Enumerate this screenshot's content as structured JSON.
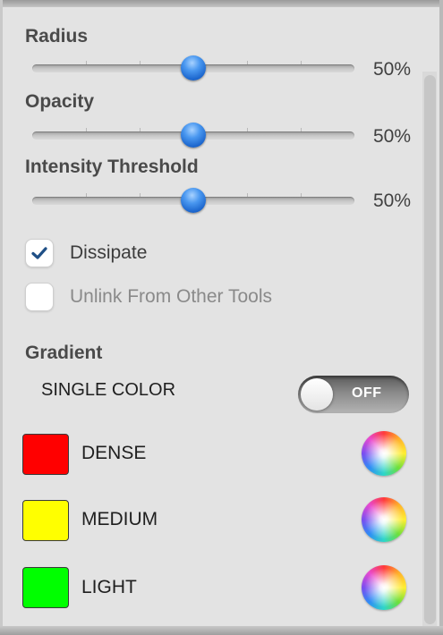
{
  "sliders": [
    {
      "label": "Radius",
      "value": 50,
      "value_text": "50%"
    },
    {
      "label": "Opacity",
      "value": 50,
      "value_text": "50%"
    },
    {
      "label": "Intensity Threshold",
      "value": 50,
      "value_text": "50%"
    }
  ],
  "checkboxes": [
    {
      "label": "Dissipate",
      "checked": true
    },
    {
      "label": "Unlink From Other Tools",
      "checked": false
    }
  ],
  "gradient": {
    "title": "Gradient",
    "single_color_label": "SINGLE COLOR",
    "toggle_text": "OFF",
    "toggle_on": false,
    "swatches": [
      {
        "label": "DENSE",
        "color": "#ff0000"
      },
      {
        "label": "MEDIUM",
        "color": "#ffff00"
      },
      {
        "label": "LIGHT",
        "color": "#00ff00"
      }
    ]
  },
  "colors": {
    "slider_knob": "#2a7be4",
    "checkmark": "#1f4f86"
  }
}
